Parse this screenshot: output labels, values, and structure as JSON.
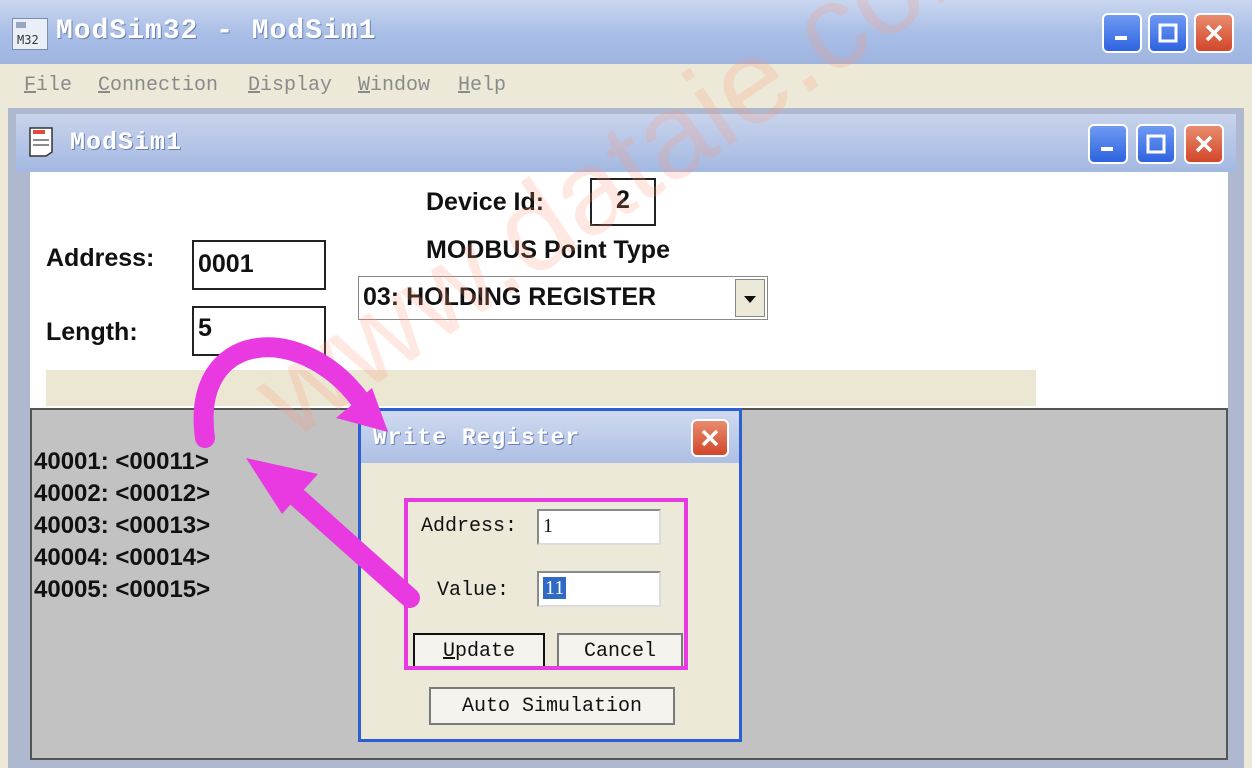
{
  "app": {
    "title": "ModSim32 - ModSim1",
    "menu": [
      {
        "u": "F",
        "rest": "ile"
      },
      {
        "u": "C",
        "rest": "onnection"
      },
      {
        "u": "D",
        "rest": "isplay"
      },
      {
        "u": "W",
        "rest": "indow"
      },
      {
        "u": "H",
        "rest": "elp"
      }
    ]
  },
  "child_window": {
    "title": "ModSim1",
    "device_id_label": "Device Id:",
    "device_id": "2",
    "point_type_label": "MODBUS Point Type",
    "point_type": "03: HOLDING REGISTER",
    "address_label": "Address:",
    "address": "0001",
    "length_label": "Length:",
    "length": "5",
    "registers": [
      "40001: <00011>",
      "40002: <00012>",
      "40003: <00013>",
      "40004: <00014>",
      "40005: <00015>"
    ]
  },
  "dialog": {
    "title": "Write Register",
    "address_label": "Address:",
    "address_value": "1",
    "value_label": "Value:",
    "value_value": "11",
    "update_u": "U",
    "update_rest": "pdate",
    "cancel_label": "Cancel",
    "auto_sim_label": "Auto Simulation"
  },
  "watermark": "www.dataie.com",
  "colors": {
    "highlight": "#e83ae0",
    "titlebar": "#a8bde6",
    "close_button": "#d2462a"
  }
}
